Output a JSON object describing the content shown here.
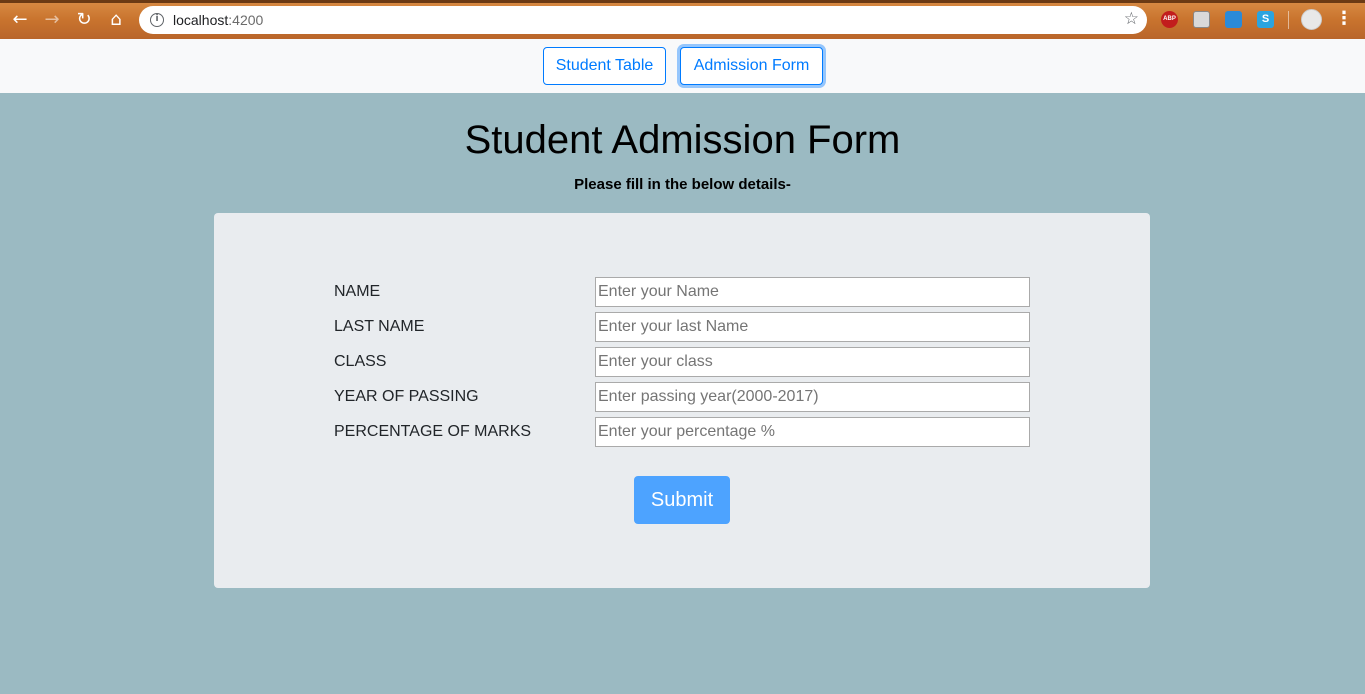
{
  "browser": {
    "url_host": "localhost",
    "url_port": ":4200",
    "back_icon": "arrow-left-icon",
    "forward_icon": "arrow-right-icon",
    "reload_icon": "reload-icon",
    "home_icon": "home-icon",
    "star_icon": "star-icon",
    "extensions": [
      "ABP",
      "",
      "",
      "S"
    ]
  },
  "nav": {
    "tabs": [
      {
        "label": "Student Table"
      },
      {
        "label": "Admission Form"
      }
    ]
  },
  "page": {
    "title": "Student Admission Form",
    "subtitle": "Please fill in the below details-"
  },
  "form": {
    "fields": [
      {
        "label": "NAME",
        "placeholder": "Enter your Name",
        "value": ""
      },
      {
        "label": "LAST NAME",
        "placeholder": "Enter your last Name",
        "value": ""
      },
      {
        "label": "CLASS",
        "placeholder": "Enter your class",
        "value": ""
      },
      {
        "label": "YEAR OF PASSING",
        "placeholder": "Enter passing year(2000-2017)",
        "value": ""
      },
      {
        "label": "PERCENTAGE OF MARKS",
        "placeholder": "Enter your percentage %",
        "value": ""
      }
    ],
    "submit_label": "Submit"
  },
  "colors": {
    "page_background": "#9bbac2",
    "card_background": "#e9ecef",
    "primary": "#007bff",
    "submit_button": "#4da3ff"
  }
}
